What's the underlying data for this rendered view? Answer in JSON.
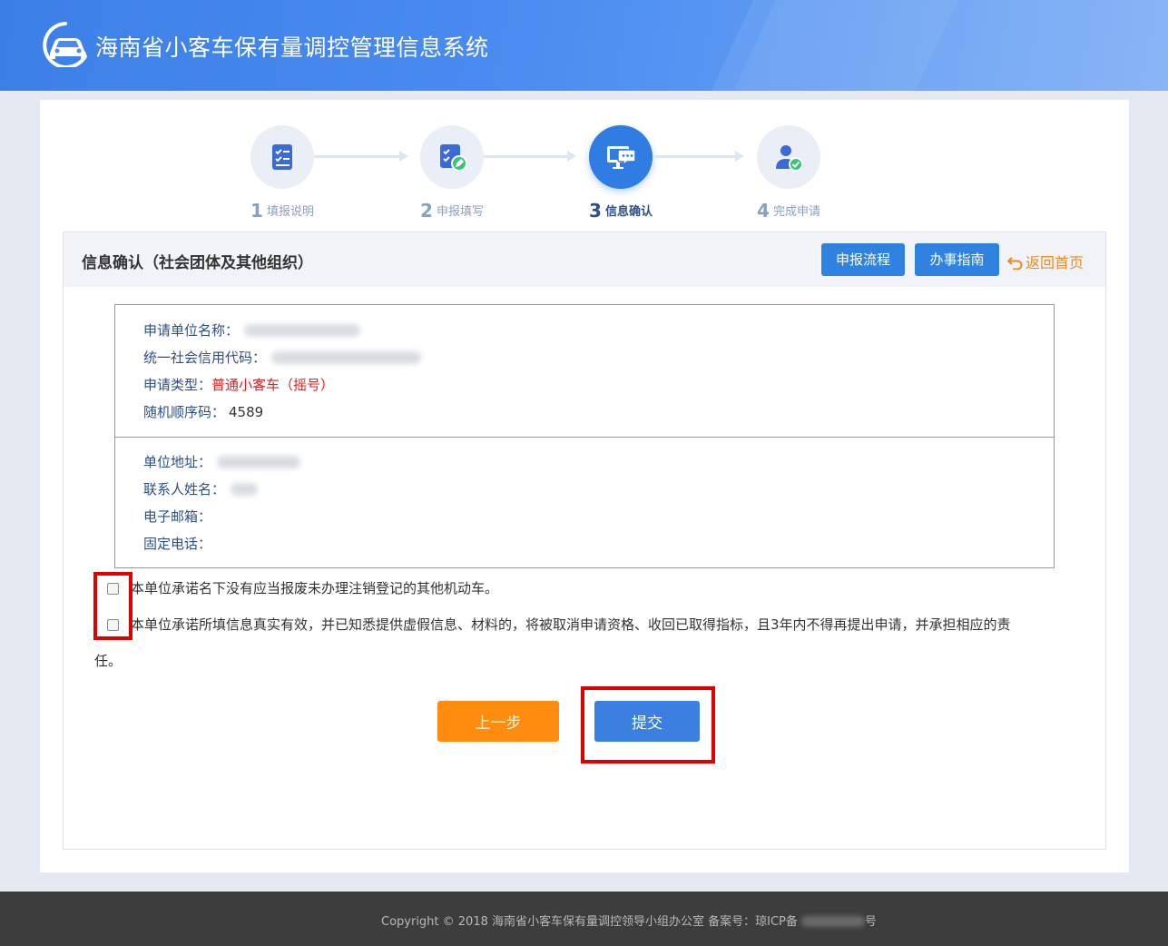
{
  "header": {
    "title": "海南省小客车保有量调控管理信息系统",
    "logo_icon": "car-logo-icon"
  },
  "steps": [
    {
      "num": "1",
      "label": "填报说明",
      "icon": "checklist-icon"
    },
    {
      "num": "2",
      "label": "申报填写",
      "icon": "edit-form-icon"
    },
    {
      "num": "3",
      "label": "信息确认",
      "icon": "monitor-chat-icon"
    },
    {
      "num": "4",
      "label": "完成申请",
      "icon": "user-check-icon"
    }
  ],
  "active_step": 3,
  "panel": {
    "title": "信息确认（社会团体及其他组织）",
    "process_button": "申报流程",
    "guide_button": "办事指南",
    "back_link": "返回首页"
  },
  "info": {
    "org_name_label": "申请单位名称：",
    "credit_code_label": "统一社会信用代码：",
    "apply_type_label": "申请类型：",
    "apply_type_value": "普通小客车（摇号）",
    "random_code_label": "随机顺序码：",
    "random_code_value": "4589",
    "address_label": "单位地址：",
    "contact_label": "联系人姓名：",
    "email_label": "电子邮箱：",
    "phone_label": "固定电话："
  },
  "commitments": {
    "item1": "本单位承诺名下没有应当报废未办理注销登记的其他机动车。",
    "item2_line1": "本单位承诺所填信息真实有效，并已知悉提供虚假信息、材料的，将被取消申请资格、收回已取得指标，且3年内不得再提出申请，并承担相应的责",
    "item2_line2": "任。"
  },
  "buttons": {
    "prev": "上一步",
    "submit": "提交"
  },
  "footer": {
    "copyright": "Copyright  © 2018    海南省小客车保有量调控领导小组办公室     备案号：琼ICP备",
    "suffix": "号"
  },
  "colors": {
    "header": "#4a8cef",
    "primary": "#2f82e0",
    "orange": "#ff8c0f",
    "highlight": "#e00000",
    "red_text": "#e02020"
  }
}
